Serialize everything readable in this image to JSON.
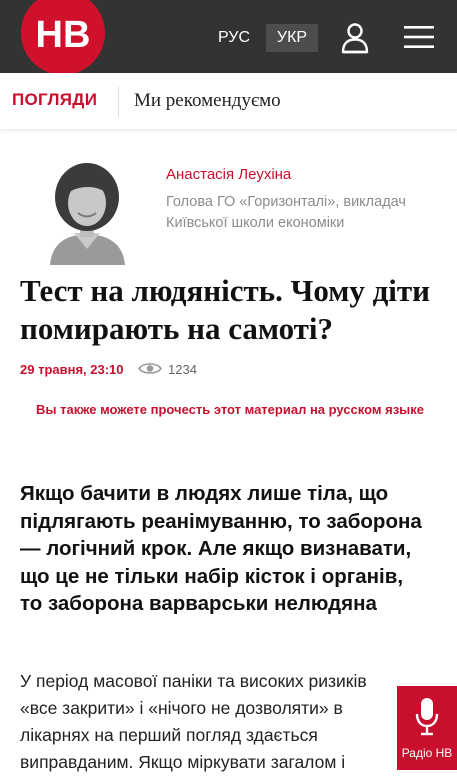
{
  "header": {
    "logo_text": "НВ",
    "lang_ru": "РУС",
    "lang_ua": "УКР",
    "user_icon": "user-icon",
    "menu_icon": "hamburger-menu-icon"
  },
  "section": {
    "name": "ПОГЛЯДИ",
    "link": "Ми рекомендуємо"
  },
  "author": {
    "name": "Анастасія Леухіна",
    "bio": "Голова ГО «Горизонталі», викладач Київської школи економіки"
  },
  "article": {
    "title": "Тест на людяність. Чому діти помирають на самоті?",
    "date": "29 травня, 23:10",
    "views": "1234",
    "ru_link": "Вы также можете прочесть этот материал на русском языке",
    "lead": "Якщо бачити в людях лише тіла, що підлягають реанімуванню, то заборона — логічний крок. Але якщо визнавати, що це не тільки набір кісток і органів, то заборона варварськи нелюдяна",
    "body": "У період масової паніки та високих ризиків «все закрити» і «нічого не дозволяти» в лікарнях на перший погляд здається виправданим. Якщо міркувати загалом і"
  },
  "radio": {
    "label": "Радіо НВ",
    "icon": "microphone-icon"
  },
  "colors": {
    "brand_red": "#c8102e",
    "header_bg": "#333333"
  }
}
